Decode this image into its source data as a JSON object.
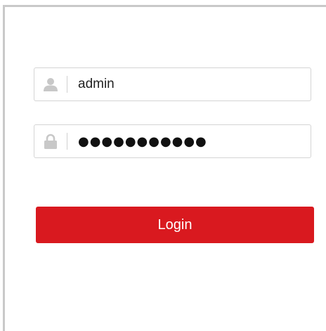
{
  "login_form": {
    "username": {
      "icon": "user-icon",
      "value": "admin"
    },
    "password": {
      "icon": "lock-icon",
      "masked_value": "●●●●●●●●●●●"
    },
    "login_button_label": "Login"
  },
  "colors": {
    "accent": "#d9191f",
    "icon": "#c8c8c8",
    "field_border": "#d4d4d4",
    "panel_border": "#c9c9c9"
  }
}
